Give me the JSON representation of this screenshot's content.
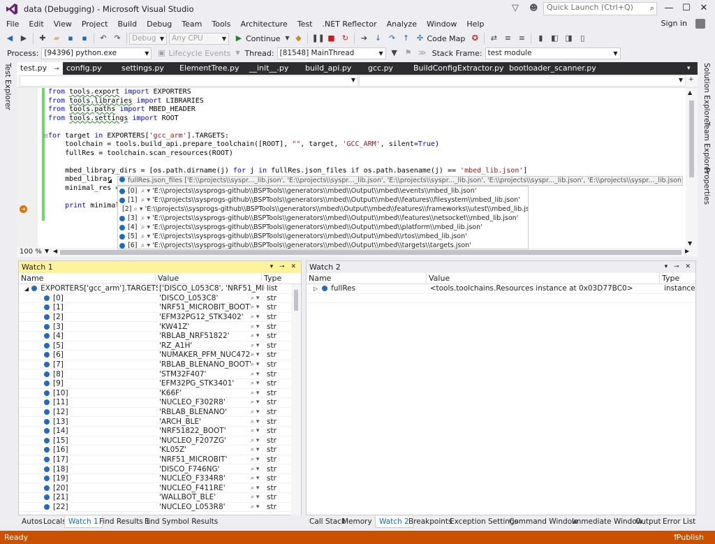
{
  "window": {
    "title": "data (Debugging) - Microsoft Visual Studio",
    "quick_launch_placeholder": "Quick Launch (Ctrl+Q)",
    "sign_in": "Sign in"
  },
  "menu": [
    "File",
    "Edit",
    "View",
    "Project",
    "Build",
    "Debug",
    "Team",
    "Tools",
    "Architecture",
    "Test",
    ".NET Reflector",
    "Analyze",
    "Window",
    "Help"
  ],
  "toolbar": {
    "config": "Debug",
    "platform": "Any CPU",
    "continue": "Continue",
    "code_map": "Code Map"
  },
  "debugbar": {
    "process_label": "Process:",
    "process": "[94396] python.exe",
    "lifecycle": "Lifecycle Events",
    "thread_label": "Thread:",
    "thread": "[81548] MainThread",
    "stack_label": "Stack Frame:",
    "stack": "test module"
  },
  "side_left": [
    "Test Explorer"
  ],
  "side_right": [
    "Solution Explorer",
    "Team Explorer",
    "Properties"
  ],
  "tabs": [
    "test.py",
    "config.py",
    "settings.py",
    "ElementTree.py",
    "__init__.py",
    "build_api.py",
    "gcc.py",
    "BuildConfigExtractor.py",
    "bootloader_scanner.py"
  ],
  "editor": {
    "zoom": "100 %",
    "lines": [
      {
        "parts": [
          [
            "kw",
            "from "
          ],
          [
            "und",
            "tools.export"
          ],
          [
            "kw",
            " import "
          ],
          [
            "t",
            "EXPORTERS"
          ]
        ]
      },
      {
        "parts": [
          [
            "kw",
            "from "
          ],
          [
            "und",
            "tools.libraries"
          ],
          [
            "kw",
            " import "
          ],
          [
            "t",
            "LIBRARIES"
          ]
        ]
      },
      {
        "parts": [
          [
            "kw",
            "from "
          ],
          [
            "und",
            "tools.paths"
          ],
          [
            "kw",
            " import "
          ],
          [
            "t",
            "MBED_HEADER"
          ]
        ]
      },
      {
        "parts": [
          [
            "kw",
            "from "
          ],
          [
            "und",
            "tools.settings"
          ],
          [
            "kw",
            " import "
          ],
          [
            "t",
            "ROOT"
          ]
        ]
      },
      {
        "parts": [
          [
            "t",
            ""
          ]
        ]
      },
      {
        "parts": [
          [
            "kw",
            "for "
          ],
          [
            "t",
            "target "
          ],
          [
            "kw",
            "in "
          ],
          [
            "t",
            "EXPORTERS["
          ],
          [
            "str",
            "'gcc_arm'"
          ],
          [
            "t",
            "].TARGETS:"
          ]
        ]
      },
      {
        "parts": [
          [
            "t",
            "    toolchain = tools.build_api.prepare_toolchain([ROOT], "
          ],
          [
            "str",
            "\"\""
          ],
          [
            "t",
            ", target, "
          ],
          [
            "str",
            "'GCC_ARM'"
          ],
          [
            "t",
            ", silent="
          ],
          [
            "kw",
            "True"
          ],
          [
            "t",
            ")"
          ]
        ]
      },
      {
        "parts": [
          [
            "t",
            "    fullRes = toolchain.scan_resources(ROOT)"
          ]
        ]
      },
      {
        "parts": [
          [
            "t",
            ""
          ]
        ]
      },
      {
        "parts": [
          [
            "t",
            "    mbed_library_dirs = [os.path.dirname(j) "
          ],
          [
            "kw",
            "for "
          ],
          [
            "t",
            "j "
          ],
          [
            "kw",
            "in "
          ],
          [
            "t",
            "fullRes.json_files "
          ],
          [
            "kw",
            "if "
          ],
          [
            "t",
            "os.path.basename(j) == "
          ],
          [
            "str",
            "'mbed_lib.json'"
          ],
          [
            "t",
            "]"
          ]
        ]
      },
      {
        "parts": [
          [
            "t",
            "    mbed_librar"
          ]
        ]
      },
      {
        "parts": [
          [
            "t",
            "    minimal_res ="
          ]
        ]
      },
      {
        "parts": [
          [
            "t",
            ""
          ]
        ]
      },
      {
        "parts": [
          [
            "t",
            "    "
          ],
          [
            "kw",
            "print "
          ],
          [
            "t",
            "minimal"
          ]
        ]
      }
    ]
  },
  "datatip": {
    "header": "fullRes.json_files  ['E:\\\\projects\\\\syspr..._lib.json', 'E:\\\\projects\\\\syspr..._lib.json', 'E:\\\\projects\\\\syspr..._lib.json', 'E:\\\\projects\\\\syspr..._lib.json', 'E:\\\\projects\\\\syspr..._lib.json', 'E:\\\\projects\\\\syspr..._lib.json', 'E:\\\\projects...",
    "items": [
      {
        "idx": "[0]",
        "val": "'E:\\\\projects\\\\sysprogs-github\\\\BSPTools\\\\generators\\\\mbed\\\\Output\\\\mbed\\\\events\\\\mbed_lib.json'"
      },
      {
        "idx": "[1]",
        "val": "'E:\\\\projects\\\\sysprogs-github\\\\BSPTools\\\\generators\\\\mbed\\\\Output\\\\mbed\\\\features\\\\filesystem\\\\mbed_lib.json'"
      },
      {
        "idx": "[2]",
        "val": "'E:\\\\projects\\\\sysprogs-github\\\\BSPTools\\\\generators\\\\mbed\\\\Output\\\\mbed\\\\features\\\\frameworks\\\\utest\\\\mbed_lib.json'"
      },
      {
        "idx": "[3]",
        "val": "'E:\\\\projects\\\\sysprogs-github\\\\BSPTools\\\\generators\\\\mbed\\\\Output\\\\mbed\\\\features\\\\netsocket\\\\mbed_lib.json'"
      },
      {
        "idx": "[4]",
        "val": "'E:\\\\projects\\\\sysprogs-github\\\\BSPTools\\\\generators\\\\mbed\\\\Output\\\\mbed\\\\platform\\\\mbed_lib.json'"
      },
      {
        "idx": "[5]",
        "val": "'E:\\\\projects\\\\sysprogs-github\\\\BSPTools\\\\generators\\\\mbed\\\\Output\\\\mbed\\\\rtos\\\\mbed_lib.json'"
      },
      {
        "idx": "[6]",
        "val": "'E:\\\\projects\\\\sysprogs-github\\\\BSPTools\\\\generators\\\\mbed\\\\Output\\\\mbed\\\\targets\\\\targets.json'"
      }
    ]
  },
  "watch1": {
    "title": "Watch 1",
    "cols": [
      "Name",
      "Value",
      "Type"
    ],
    "root": {
      "name": "EXPORTERS['gcc_arm'].TARGETS",
      "value": "['DISCO_L053C8', 'NRF51_MICROBIT",
      "type": "list"
    },
    "rows": [
      [
        "[0]",
        "'DISCO_L053C8'"
      ],
      [
        "[1]",
        "'NRF51_MICROBIT_BOOT'"
      ],
      [
        "[2]",
        "'EFM32PG12_STK3402'"
      ],
      [
        "[3]",
        "'KW41Z'"
      ],
      [
        "[4]",
        "'RBLAB_NRF51822'"
      ],
      [
        "[5]",
        "'RZ_A1H'"
      ],
      [
        "[6]",
        "'NUMAKER_PFM_NUC472'"
      ],
      [
        "[7]",
        "'RBLAB_BLENANO_BOOT'"
      ],
      [
        "[8]",
        "'STM32F407'"
      ],
      [
        "[9]",
        "'EFM32PG_STK3401'"
      ],
      [
        "[10]",
        "'K66F'"
      ],
      [
        "[11]",
        "'NUCLEO_F302R8'"
      ],
      [
        "[12]",
        "'RBLAB_BLENANO'"
      ],
      [
        "[13]",
        "'ARCH_BLE'"
      ],
      [
        "[14]",
        "'NRF51822_BOOT'"
      ],
      [
        "[15]",
        "'NUCLEO_F207ZG'"
      ],
      [
        "[16]",
        "'KL05Z'"
      ],
      [
        "[17]",
        "'NRF51_MICROBIT'"
      ],
      [
        "[18]",
        "'DISCO_F746NG'"
      ],
      [
        "[19]",
        "'NUCLEO_F334R8'"
      ],
      [
        "[20]",
        "'NUCLEO_F411RE'"
      ],
      [
        "[21]",
        "'WALLBOT_BLE'"
      ],
      [
        "[22]",
        "'NUCLEO_L053R8'"
      ]
    ],
    "row_type": "str"
  },
  "watch2": {
    "title": "Watch 2",
    "cols": [
      "Name",
      "Value",
      "Type"
    ],
    "rows": [
      {
        "name": "fullRes",
        "value": "<tools.toolchains.Resources instance at 0x03D77BC0>",
        "type": "instance"
      }
    ]
  },
  "bottom_tabs_left": [
    "Autos",
    "Locals",
    "Watch 1",
    "Find Results 1",
    "Find Symbol Results"
  ],
  "bottom_tabs_right": [
    "Call Stack",
    "Memory 1",
    "Watch 2",
    "Breakpoints",
    "Exception Settings",
    "Command Window",
    "Immediate Window",
    "Output",
    "Error List"
  ],
  "status": {
    "left": "Ready",
    "right": "Publish"
  },
  "colors": {
    "accent": "#007acc",
    "status": "#ca5100",
    "watch_header": "#fff29d",
    "keyword": "#0000ff",
    "string": "#a31515"
  }
}
